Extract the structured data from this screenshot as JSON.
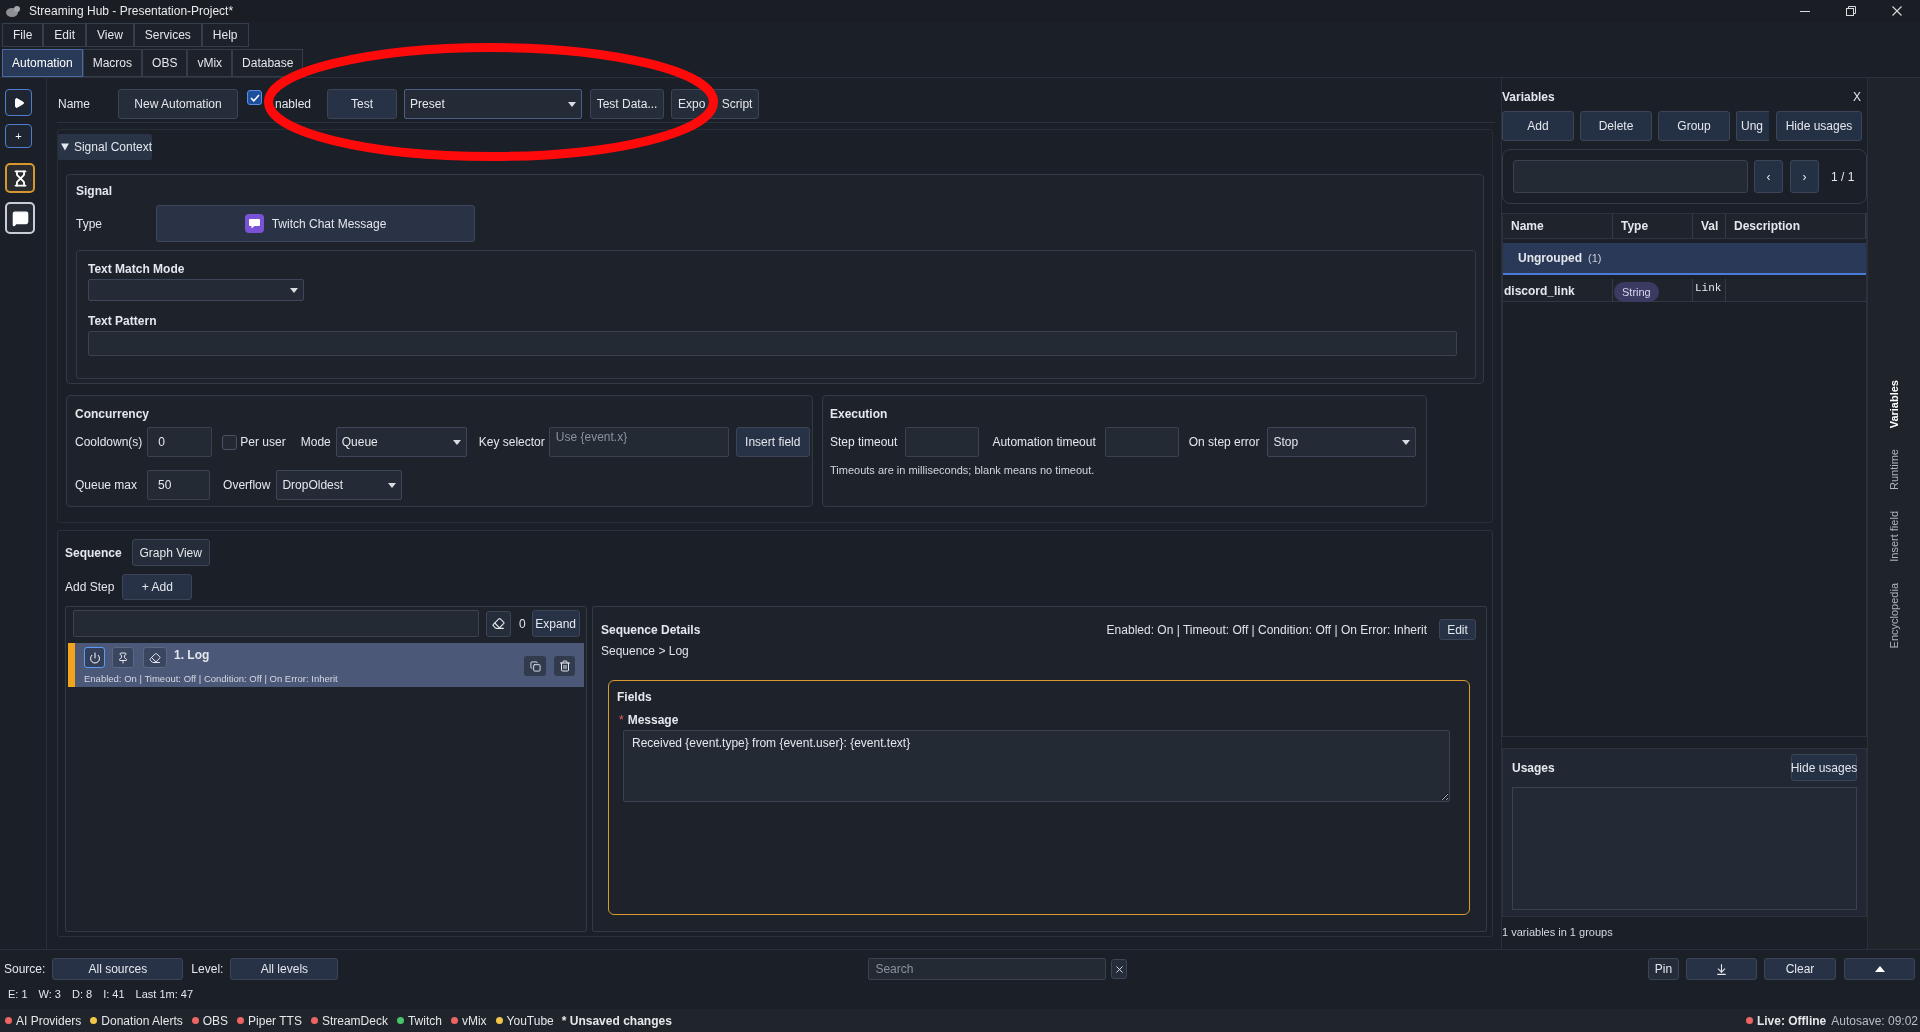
{
  "window": {
    "title": "Streaming Hub - Presentation-Project*"
  },
  "menu": [
    "File",
    "Edit",
    "View",
    "Services",
    "Help"
  ],
  "tabs": [
    {
      "label": "Automation",
      "selected": true
    },
    {
      "label": "Macros",
      "selected": false
    },
    {
      "label": "OBS",
      "selected": false
    },
    {
      "label": "vMix",
      "selected": false
    },
    {
      "label": "Database",
      "selected": false
    }
  ],
  "sidebar": {
    "items": [
      {
        "kind": "play"
      },
      {
        "kind": "add",
        "label": "+"
      },
      {
        "kind": "timer"
      },
      {
        "kind": "chat"
      }
    ]
  },
  "toolbar": {
    "name_label": "Name",
    "name_button": "New Automation",
    "enabled": {
      "label": "nabled",
      "checked": true
    },
    "test_button": "Test",
    "preset": {
      "value": "Preset"
    },
    "test_data_button": "Test Data...",
    "export_button": "Expo Script"
  },
  "annotations": [
    {
      "kind": "ellipse"
    }
  ],
  "signal_context": {
    "title": "Signal Context",
    "expanded": true,
    "signal": {
      "title": "Signal",
      "type_label": "Type",
      "type_value": "Twitch Chat Message",
      "text_match_mode": {
        "label": "Text Match Mode"
      },
      "text_pattern": {
        "label": "Text Pattern"
      }
    },
    "concurrency": {
      "title": "Concurrency",
      "cooldown": {
        "label": "Cooldown(s)",
        "value": "0"
      },
      "per_user": {
        "label": "Per user",
        "checked": false
      },
      "mode": {
        "label": "Mode",
        "value": "Queue"
      },
      "key_selector": {
        "label": "Key selector",
        "placeholder": "Use {event.x}"
      },
      "insert_field_button": "Insert field",
      "queue_max": {
        "label": "Queue max",
        "value": "50"
      },
      "overflow": {
        "label": "Overflow",
        "value": "DropOldest"
      }
    },
    "execution": {
      "title": "Execution",
      "step_timeout": {
        "label": "Step timeout"
      },
      "automation_timeout": {
        "label": "Automation timeout"
      },
      "on_step_error": {
        "label": "On step error",
        "value": "Stop"
      },
      "note": "Timeouts are in milliseconds; blank means no timeout."
    }
  },
  "sequence": {
    "title": "Sequence",
    "graph_view_button": "Graph View",
    "add_step_label": "Add Step",
    "add_button": "+ Add",
    "count": "0",
    "expand_button": "Expand",
    "steps": [
      {
        "title": "1. Log",
        "summary": "Enabled: On | Timeout: Off | Condition: Off | On Error: Inherit",
        "selected": true,
        "enabled": true
      }
    ],
    "details": {
      "title": "Sequence Details",
      "summary": "Enabled: On | Timeout: Off | Condition: Off | On Error: Inherit",
      "edit_button": "Edit",
      "breadcrumb": "Sequence > Log",
      "fields_title": "Fields",
      "fields": [
        {
          "label": "Message",
          "required": true,
          "required_mark": "*",
          "value": "Received {event.type} from {event.user}: {event.text}"
        }
      ]
    }
  },
  "variables_panel": {
    "title": "Variables",
    "close_label": "X",
    "buttons": [
      "Add",
      "Delete",
      "Group",
      "Ung",
      "Hide usages"
    ],
    "pager": {
      "prev": "‹",
      "next": "›",
      "page": "1 / 1"
    },
    "table": {
      "columns": [
        "Name",
        "Type",
        "Val",
        "Description"
      ],
      "groups": [
        {
          "name": "Ungrouped",
          "count": "(1)",
          "rows": [
            {
              "name": "discord_link",
              "type": "String",
              "value": "Link"
            }
          ]
        }
      ]
    },
    "usages": {
      "title": "Usages",
      "hide_button": "Hide usages"
    },
    "footer": "1 variables in 1 groups"
  },
  "side_tabs": [
    {
      "label": "Variables",
      "selected": true
    },
    {
      "label": "Runtime",
      "selected": false
    },
    {
      "label": "Insert field",
      "selected": false
    },
    {
      "label": "Encyclopedia",
      "selected": false
    }
  ],
  "log": {
    "source_label": "Source:",
    "source_value": "All sources",
    "level_label": "Level:",
    "level_value": "All levels",
    "search": {
      "placeholder": "Search"
    },
    "pin_button": "Pin",
    "clear_button": "Clear",
    "stats": [
      "E: 1",
      "W: 3",
      "D: 8",
      "I: 41",
      "Last 1m: 47"
    ]
  },
  "status_bar": {
    "providers": [
      {
        "name": "AI Providers",
        "color": "#ef6464"
      },
      {
        "name": "Donation Alerts",
        "color": "#f2c54b"
      },
      {
        "name": "OBS",
        "color": "#ef6464"
      },
      {
        "name": "Piper TTS",
        "color": "#ef6464"
      },
      {
        "name": "StreamDeck",
        "color": "#ef6464"
      },
      {
        "name": "Twitch",
        "color": "#4cc46a"
      },
      {
        "name": "vMix",
        "color": "#ef6464"
      },
      {
        "name": "YouTube",
        "color": "#f2c54b"
      }
    ],
    "unsaved": "* Unsaved changes",
    "live": {
      "label": "Live: Offline",
      "color": "#ef6464"
    },
    "autosave": "Autosave: 09:02"
  }
}
